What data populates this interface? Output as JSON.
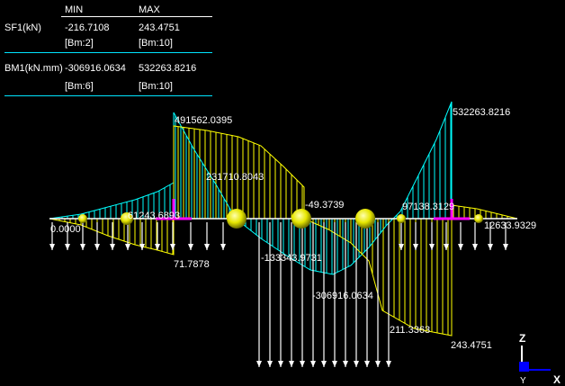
{
  "table": {
    "col_min": "MIN",
    "col_max": "MAX",
    "rows": [
      {
        "name": "SF1(kN)",
        "min": "-216.7108",
        "max": "243.4751",
        "min_ref": "[Bm:2]",
        "max_ref": "[Bm:10]"
      },
      {
        "name": "BM1(kN.mm)",
        "min": "-306916.0634",
        "max": "532263.8216",
        "min_ref": "[Bm:6]",
        "max_ref": "[Bm:10]"
      }
    ]
  },
  "labels": {
    "l1": "491562.0395",
    "l2": "532263.8216",
    "l3": "231710.8043",
    "l4": "-49.3739",
    "l5": "97138.3129",
    "l6": "61243.6893",
    "l7": "0.0000",
    "l8": "12633.9329",
    "l9": "71.7878",
    "l10": "-133343.9731",
    "l11": "-306916.0634",
    "l12": "211.3363",
    "l13": "243.4751"
  },
  "axes": {
    "z": "Z",
    "y": "Y",
    "x": "X"
  },
  "colors": {
    "beam": "#ffffff",
    "bm_diagram": "#00ffff",
    "sf_diagram": "#ffff00",
    "support": "#ff00ff",
    "separator": "#00e5ff",
    "axis_z": "#ffffff",
    "axis_origin": "#0000ff"
  }
}
